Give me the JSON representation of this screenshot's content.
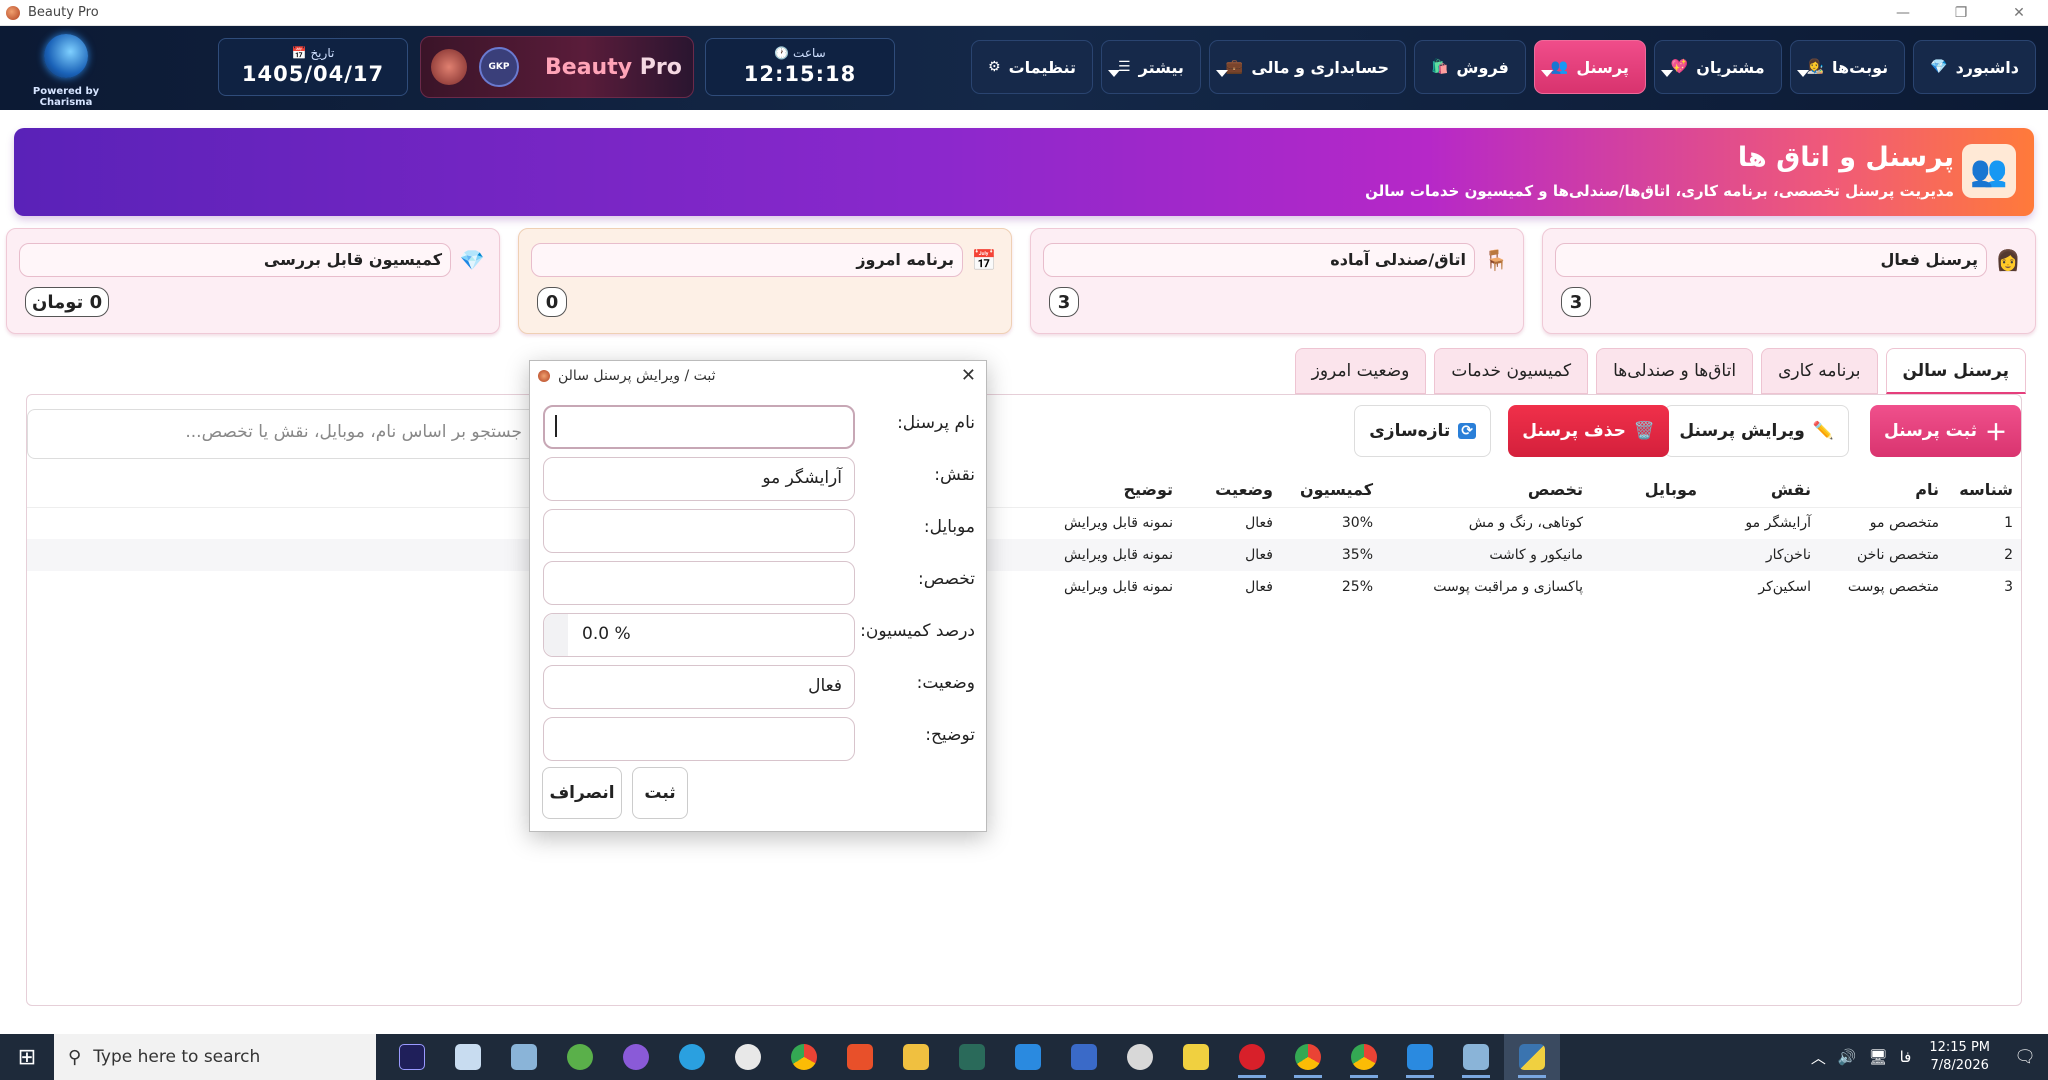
{
  "window": {
    "title": "Beauty Pro",
    "minimize": "—",
    "restore": "❐",
    "close": "✕"
  },
  "brand": {
    "powered": "Powered by Charisma",
    "name_prefix": "Beauty ",
    "name_suffix": "Pro"
  },
  "header": {
    "date_label": "📅 تاریخ",
    "date_value": "1405/04/17",
    "time_label": "🕐 ساعت",
    "time_value": "12:15:18"
  },
  "nav": [
    {
      "label": "داشبورد",
      "emoji": "💎",
      "caret": false,
      "active": false
    },
    {
      "label": "نوبت‌ها",
      "emoji": "👩‍🎨",
      "caret": true,
      "active": false
    },
    {
      "label": "مشتریان",
      "emoji": "💖",
      "caret": true,
      "active": false
    },
    {
      "label": "پرسنل",
      "emoji": "👥",
      "caret": true,
      "active": true
    },
    {
      "label": "فروش",
      "emoji": "🛍️",
      "caret": false,
      "active": false
    },
    {
      "label": "حسابداری و مالی",
      "emoji": "💼",
      "caret": true,
      "active": false
    },
    {
      "label": "بیشتر",
      "emoji": "☰",
      "caret": true,
      "active": false
    },
    {
      "label": "تنظیمات",
      "emoji": "⚙",
      "caret": false,
      "active": false
    }
  ],
  "banner": {
    "title": "پرسنل و اتاق ها",
    "subtitle": "مدیریت پرسنل تخصصی، برنامه کاری، اتاق‌ها/صندلی‌ها و کمیسیون خدمات سالن"
  },
  "cards": [
    {
      "label": "پرسنل فعال",
      "value": "3",
      "icon": "👩",
      "style": "pink"
    },
    {
      "label": "اتاق/صندلی آماده",
      "value": "3",
      "icon": "🪑",
      "style": "pink"
    },
    {
      "label": "برنامه امروز",
      "value": "0",
      "icon": "📅",
      "style": "yellow"
    },
    {
      "label": "کمیسیون قابل بررسی",
      "value": "0 تومان",
      "icon": "💎",
      "style": "pink"
    }
  ],
  "tabs": [
    {
      "label": "پرسنل سالن",
      "active": true
    },
    {
      "label": "برنامه کاری",
      "active": false
    },
    {
      "label": "اتاق‌ها و صندلی‌ها",
      "active": false
    },
    {
      "label": "کمیسیون خدمات",
      "active": false
    },
    {
      "label": "وضعیت امروز",
      "active": false
    }
  ],
  "toolbar": {
    "add": "ثبت پرسنل",
    "edit": "ویرایش پرسنل",
    "delete": "حذف پرسنل",
    "refresh": "تازه‌سازی",
    "search_placeholder": "جستجو بر اساس نام، موبایل، نقش یا تخصص..."
  },
  "table": {
    "columns": [
      "شناسه",
      "نام",
      "نقش",
      "موبایل",
      "تخصص",
      "کمیسیون",
      "وضعیت",
      "توضیح"
    ],
    "rows": [
      [
        "1",
        "متخصص مو",
        "آرایشگر مو",
        "",
        "کوتاهی، رنگ و مش",
        "30%",
        "فعال",
        "نمونه قابل ویرایش"
      ],
      [
        "2",
        "متخصص ناخن",
        "ناخن‌کار",
        "",
        "مانیکور و کاشت",
        "35%",
        "فعال",
        "نمونه قابل ویرایش"
      ],
      [
        "3",
        "متخصص پوست",
        "اسکین‌کر",
        "",
        "پاکسازی و مراقبت پوست",
        "25%",
        "فعال",
        "نمونه قابل ویرایش"
      ]
    ]
  },
  "dialog": {
    "title": "ثبت / ویرایش پرسنل سالن",
    "fields": [
      {
        "label": "نام پرسنل:",
        "value": ""
      },
      {
        "label": "نقش:",
        "value": "آرایشگر مو"
      },
      {
        "label": "موبایل:",
        "value": ""
      },
      {
        "label": "تخصص:",
        "value": ""
      },
      {
        "label": "درصد کمیسیون:",
        "value": "0.0 %"
      },
      {
        "label": "وضعیت:",
        "value": "فعال"
      },
      {
        "label": "توضیح:",
        "value": ""
      }
    ],
    "submit": "ثبت",
    "cancel": "انصراف"
  },
  "taskbar": {
    "search_placeholder": "Type here to search",
    "time": "12:15 PM",
    "date": "7/8/2026",
    "lang": "فا"
  }
}
